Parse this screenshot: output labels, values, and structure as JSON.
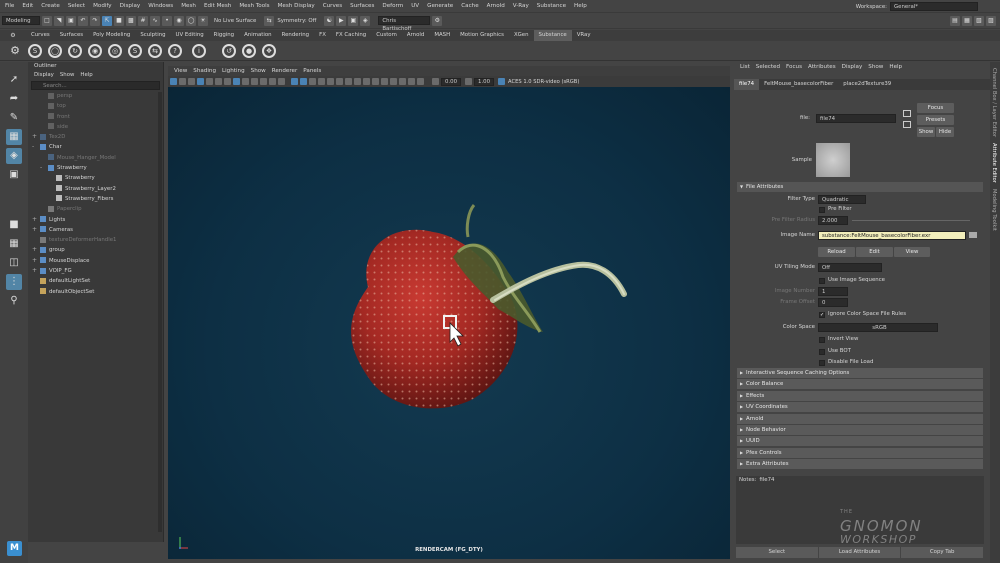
{
  "menubar": {
    "items": [
      "File",
      "Edit",
      "Create",
      "Select",
      "Modify",
      "Display",
      "Windows",
      "Mesh",
      "Edit Mesh",
      "Mesh Tools",
      "Mesh Display",
      "Curves",
      "Surfaces",
      "Deform",
      "UV",
      "Generate",
      "Cache",
      "Arnold",
      "V-Ray",
      "Substance",
      "Help"
    ],
    "workspace_label": "Workspace:",
    "workspace_value": "General*"
  },
  "statusline": {
    "mode": "Modeling",
    "live_surface": "No Live Surface",
    "symmetry": "Symmetry: Off",
    "user": "Chris Bartischoff"
  },
  "shelf": {
    "tabs": [
      "Curves",
      "Surfaces",
      "Poly Modeling",
      "Sculpting",
      "UV Editing",
      "Rigging",
      "Animation",
      "Rendering",
      "FX",
      "FX Caching",
      "Custom",
      "Arnold",
      "MASH",
      "Motion Graphics",
      "XGen",
      "Substance",
      "VRay"
    ],
    "active_tab": "Substance"
  },
  "outliner": {
    "title": "Outliner",
    "menu": [
      "Display",
      "Show",
      "Help"
    ],
    "search_placeholder": "Search...",
    "items": [
      {
        "label": "persp",
        "indent": 1,
        "dim": true,
        "icon": "camera"
      },
      {
        "label": "top",
        "indent": 1,
        "dim": true,
        "icon": "camera"
      },
      {
        "label": "front",
        "indent": 1,
        "dim": true,
        "icon": "camera"
      },
      {
        "label": "side",
        "indent": 1,
        "dim": true,
        "icon": "camera"
      },
      {
        "label": "Tex2D",
        "indent": 0,
        "dim": true,
        "icon": "group",
        "expand": "+"
      },
      {
        "label": "Char",
        "indent": 0,
        "dim": false,
        "icon": "group",
        "expand": "-"
      },
      {
        "label": "Mouse_Hanger_Model",
        "indent": 1,
        "dim": true,
        "icon": "group"
      },
      {
        "label": "Strawberry",
        "indent": 1,
        "dim": false,
        "icon": "group",
        "expand": "-"
      },
      {
        "label": "Strawberry",
        "indent": 2,
        "dim": false,
        "icon": "mesh"
      },
      {
        "label": "Strawberry_Layer2",
        "indent": 2,
        "dim": false,
        "icon": "mesh"
      },
      {
        "label": "Strawberry_Fibers",
        "indent": 2,
        "dim": false,
        "icon": "mesh"
      },
      {
        "label": "Paperclip",
        "indent": 1,
        "dim": true,
        "icon": "mesh"
      },
      {
        "label": "Lights",
        "indent": 0,
        "dim": false,
        "icon": "group",
        "expand": "+"
      },
      {
        "label": "Cameras",
        "indent": 0,
        "dim": false,
        "icon": "group",
        "expand": "+"
      },
      {
        "label": "textureDeformerHandle1",
        "indent": 0,
        "dim": true,
        "icon": "mesh"
      },
      {
        "label": "group",
        "indent": 0,
        "dim": false,
        "icon": "group",
        "expand": "+"
      },
      {
        "label": "MouseDisplace",
        "indent": 0,
        "dim": false,
        "icon": "group",
        "expand": "+"
      },
      {
        "label": "VOIP_FG",
        "indent": 0,
        "dim": false,
        "icon": "group",
        "expand": "+"
      },
      {
        "label": "defaultLightSet",
        "indent": 0,
        "dim": false,
        "icon": "set"
      },
      {
        "label": "defaultObjectSet",
        "indent": 0,
        "dim": false,
        "icon": "set"
      }
    ]
  },
  "viewport": {
    "menu": [
      "View",
      "Shading",
      "Lighting",
      "Show",
      "Renderer",
      "Panels"
    ],
    "field1": "0.00",
    "field2": "1.00",
    "colorspace": "ACES 1.0 SDR-video (sRGB)",
    "camera_label": "RENDERCAM (FG_DTY)"
  },
  "attr": {
    "menu": [
      "List",
      "Selected",
      "Focus",
      "Attributes",
      "Display",
      "Show",
      "Help"
    ],
    "tabs": [
      "file74",
      "FeltMouse_basecolorFiber",
      "place2dTexture39"
    ],
    "active_tab": "file74",
    "file_label": "file:",
    "file_value": "file74",
    "focus": "Focus",
    "presets": "Presets",
    "show": "Show",
    "hide": "Hide",
    "sample_label": "Sample",
    "sections_top": "File Attributes",
    "filter_type_label": "Filter Type",
    "filter_type_value": "Quadratic",
    "pre_filter": "Pre Filter",
    "pre_filter_radius_label": "Pre Filter Radius",
    "pre_filter_radius_value": "2.000",
    "image_name_label": "Image Name",
    "image_name_value": "substance:FeltMouse_basecolorFiber.exr",
    "reload": "Reload",
    "edit": "Edit",
    "view": "View",
    "uv_tiling_label": "UV Tiling Mode",
    "uv_tiling_value": "Off",
    "use_image_sequence": "Use Image Sequence",
    "image_number_label": "Image Number",
    "image_number_value": "1",
    "frame_offset_label": "Frame Offset",
    "frame_offset_value": "0",
    "ignore_cs": "Ignore Color Space File Rules",
    "color_space_label": "Color Space",
    "color_space_value": "sRGB",
    "invert_view": "Invert View",
    "use_bot": "Use BOT",
    "disable_file_load": "Disable File Load",
    "sections": [
      "Interactive Sequence Caching Options",
      "Color Balance",
      "Effects",
      "UV Coordinates",
      "Arnold",
      "Node Behavior",
      "UUID",
      "Pfex Controls",
      "Extra Attributes"
    ],
    "notes_label": "Notes:",
    "notes_value": "file74",
    "bottom": [
      "Select",
      "Load Attributes",
      "Copy Tab"
    ]
  },
  "right_tabs": [
    "Channel Box / Layer Editor",
    "Attribute Editor",
    "Modeling Toolkit"
  ],
  "watermark": [
    "THE",
    "GNOMON",
    "WORKSHOP"
  ],
  "toolbox": {
    "logo": "M"
  }
}
